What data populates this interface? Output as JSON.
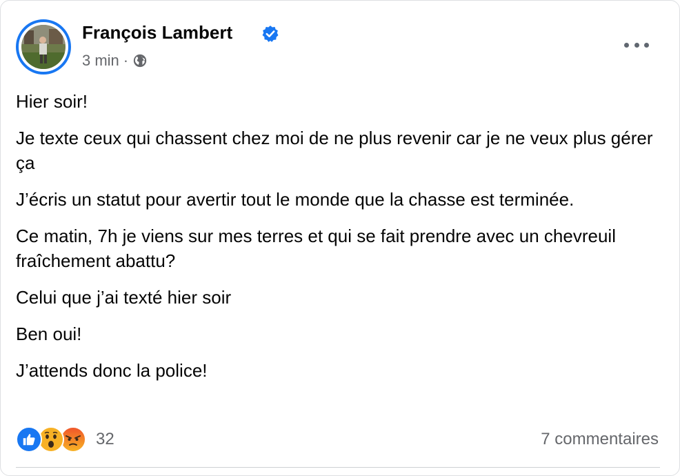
{
  "post": {
    "author_name": "François Lambert",
    "verified": true,
    "timestamp": "3 min",
    "separator": "·",
    "audience_icon": "globe-icon",
    "menu_icon": "more-options-icon",
    "paragraphs": [
      "Hier soir!",
      "Je texte ceux qui chassent chez moi de ne plus revenir car je ne veux plus gérer ça",
      "J’écris un statut pour avertir tout le monde que la chasse est terminée.",
      "Ce matin, 7h je viens sur mes terres et qui se fait prendre avec un chevreuil fraîchement abattu?",
      "Celui que j’ai texté hier soir",
      "Ben oui!",
      "J’attends donc la police!"
    ],
    "reactions": {
      "types": [
        "like",
        "wow",
        "angry"
      ],
      "count": "32"
    },
    "comments_label": "7 commentaires"
  },
  "colors": {
    "accent": "#1877f2",
    "text": "#050505",
    "secondary_text": "#65676b",
    "wow": "#f7b125",
    "angry": "#f0582a"
  }
}
